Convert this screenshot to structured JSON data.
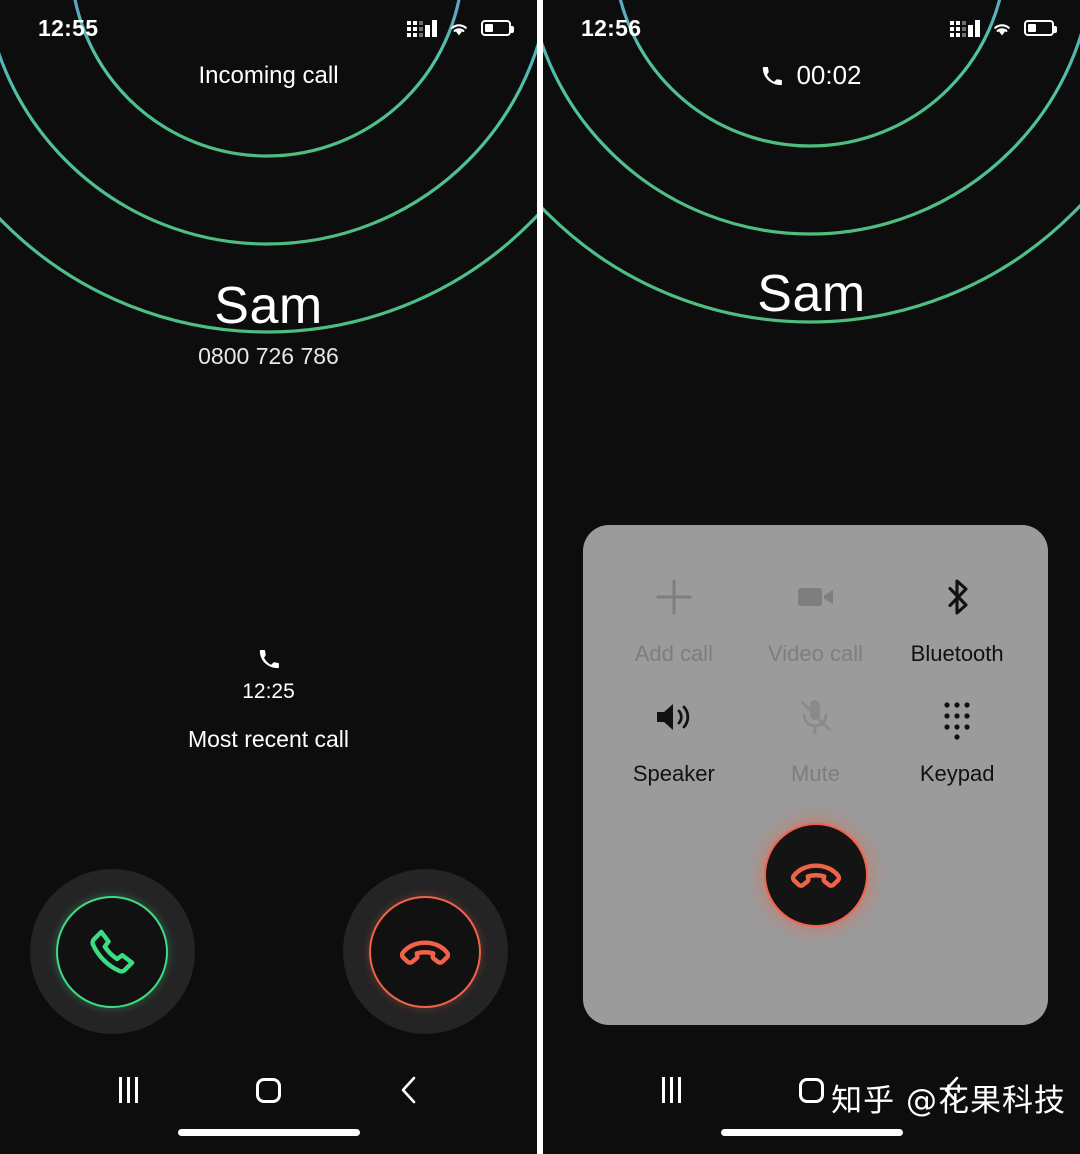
{
  "screens": [
    {
      "id": "incoming-call",
      "status_bar": {
        "time": "12:55",
        "icons": [
          "signal-icon",
          "wifi-icon",
          "battery-icon"
        ]
      },
      "header": {
        "title": "Incoming call"
      },
      "caller": {
        "name": "Sam",
        "number": "0800 726 786"
      },
      "recent_call": {
        "icon": "phone-icon",
        "time": "12:25",
        "label": "Most recent call"
      },
      "actions": [
        {
          "name": "answer-call-button",
          "icon": "phone-icon",
          "color": "#3ddc84"
        },
        {
          "name": "decline-call-button",
          "icon": "phone-hangup-icon",
          "color": "#f0634a"
        }
      ],
      "nav_bar": {
        "recents_label": "recents-button",
        "home_label": "home-button",
        "back_label": "back-button"
      }
    },
    {
      "id": "in-call",
      "status_bar": {
        "time": "12:56",
        "icons": [
          "signal-icon",
          "wifi-icon",
          "battery-icon"
        ]
      },
      "header": {
        "icon": "phone-icon",
        "duration": "00:02"
      },
      "caller": {
        "name": "Sam",
        "number": ""
      },
      "options": [
        {
          "label": "Add call",
          "icon": "plus-icon",
          "enabled": false
        },
        {
          "label": "Video call",
          "icon": "video-icon",
          "enabled": false
        },
        {
          "label": "Bluetooth",
          "icon": "bluetooth-icon",
          "enabled": true
        },
        {
          "label": "Speaker",
          "icon": "speaker-icon",
          "enabled": true
        },
        {
          "label": "Mute",
          "icon": "mic-off-icon",
          "enabled": false
        },
        {
          "label": "Keypad",
          "icon": "keypad-icon",
          "enabled": true
        }
      ],
      "end_call": {
        "name": "end-call-button",
        "icon": "phone-hangup-icon",
        "color": "#f0634a"
      },
      "nav_bar": {
        "recents_label": "recents-button",
        "home_label": "home-button",
        "back_label": "back-button"
      }
    }
  ],
  "watermark": {
    "text": "知乎 @花果科技"
  },
  "theme": {
    "background": "#0d0d0d",
    "accent_green": "#3ddc84",
    "accent_red": "#f0634a",
    "ring_purple": "#7b6ef0",
    "card_gray": "#9b9b9b"
  }
}
